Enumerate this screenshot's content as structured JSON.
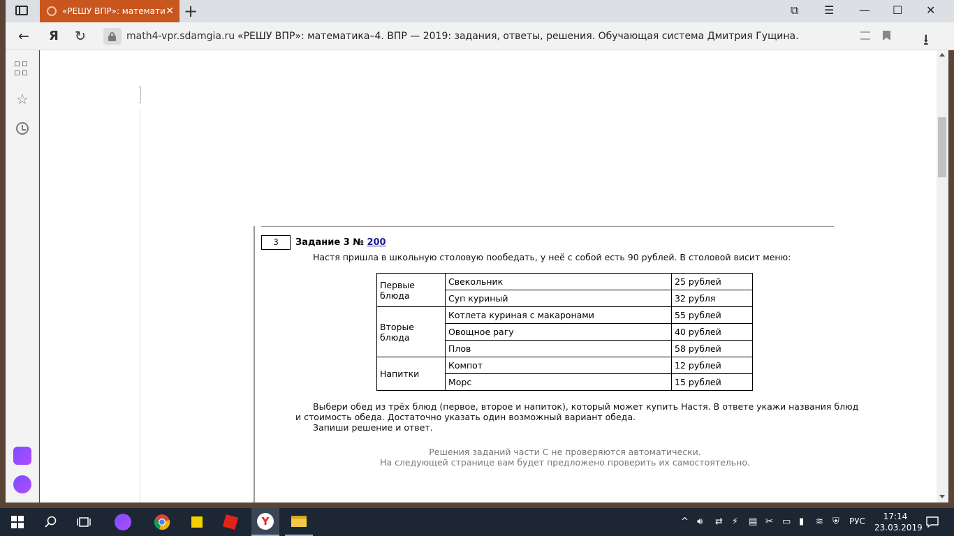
{
  "browser": {
    "tab_title": "«РЕШУ ВПР»: математи",
    "tab_close": "✕",
    "new_tab": "+",
    "url_host": "math4-vpr.sdamgia.ru",
    "page_title": "«РЕШУ ВПР»: математика–4. ВПР — 2019: задания, ответы, решения. Обучающая система Дмитрия Гущина.",
    "yandex_glyph": "Я"
  },
  "task": {
    "number": "3",
    "title_prefix": "Задание 3 №",
    "id_link": "200",
    "intro": "Настя пришла в школьную столовую пообедать, у неё с собой есть 90 рублей. В столовой висит меню:",
    "menu": {
      "first": {
        "category": "Первые блюда",
        "rows": [
          {
            "dish": "Свекольник",
            "price": "25 рублей"
          },
          {
            "dish": "Суп куриный",
            "price": "32 рубля"
          }
        ]
      },
      "second": {
        "category": "Вторые блюда",
        "rows": [
          {
            "dish": "Котлета куриная с макаронами",
            "price": "55 рублей"
          },
          {
            "dish": "Овощное рагу",
            "price": "40 рублей"
          },
          {
            "dish": "Плов",
            "price": "58 рублей"
          }
        ]
      },
      "drinks": {
        "category": "Напитки",
        "rows": [
          {
            "dish": "Компот",
            "price": "12 рублей"
          },
          {
            "dish": "Морс",
            "price": "15 рублей"
          }
        ]
      }
    },
    "question_line1": "Выбери обед из трёх блюд (первое, второе и напиток), который может купить Настя. В ответе укажи названия блюд",
    "question_line2": "и стоимость обеда. Достаточно указать один возможный вариант обеда.",
    "instruction": "Запиши решение и ответ.",
    "note_line1": "Решения заданий части С не проверяются автоматически.",
    "note_line2": "На следующей странице вам будет предложено проверить их самостоятельно."
  },
  "taskbar": {
    "language": "РУС",
    "time": "17:14",
    "date": "23.03.2019"
  }
}
